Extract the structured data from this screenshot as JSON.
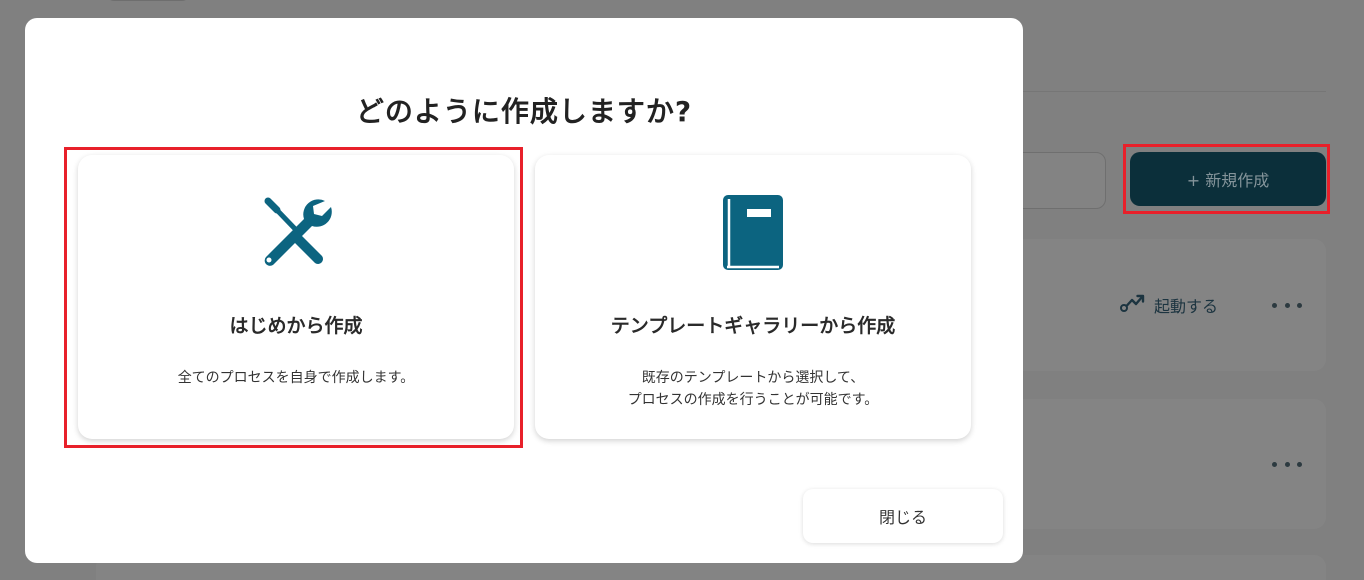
{
  "background": {
    "new_button_label": "+ 新規作成",
    "launch_label": "起動する"
  },
  "modal": {
    "title": "どのように作成しますか?",
    "options": [
      {
        "title": "はじめから作成",
        "description": "全てのプロセスを自身で作成します。",
        "icon": "tools-icon"
      },
      {
        "title": "テンプレートギャラリーから作成",
        "description_line1": "既存のテンプレートから選択して、",
        "description_line2": "プロセスの作成を行うことが可能です。",
        "icon": "book-icon"
      }
    ],
    "close_label": "閉じる"
  },
  "colors": {
    "accent": "#0c6480",
    "highlight": "#e8202a",
    "primary_button": "#0b2f3a",
    "overlay": "#808080"
  }
}
